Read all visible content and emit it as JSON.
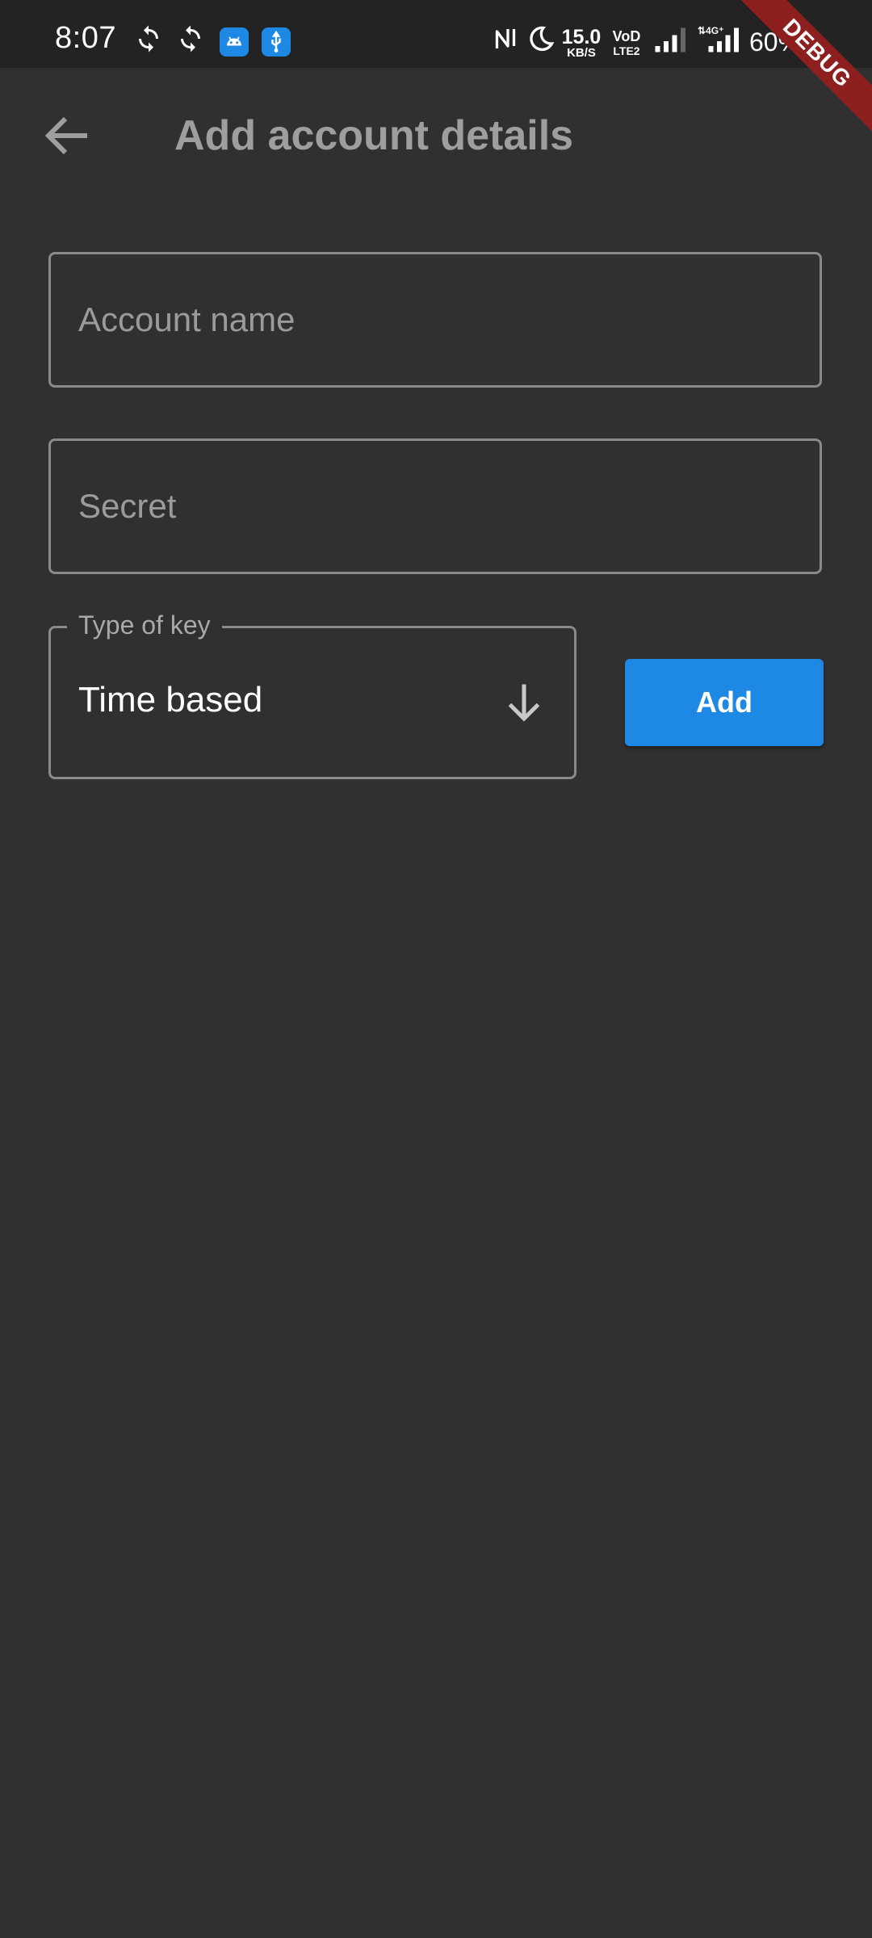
{
  "status_bar": {
    "time": "8:07",
    "net_speed_value": "15.0",
    "net_speed_unit": "KB/S",
    "vod_top": "VoD",
    "vod_bottom": "LTE2",
    "battery": "60%",
    "icons": [
      "sync-icon",
      "sync-icon",
      "android-debug-icon",
      "usb-icon",
      "nfc-icon",
      "moon-icon",
      "signal-icon",
      "signal-4g-icon"
    ]
  },
  "debug_banner": "DEBUG",
  "app_bar": {
    "title": "Add account details",
    "back_icon": "arrow-left-icon"
  },
  "form": {
    "account_name": {
      "placeholder": "Account name",
      "value": ""
    },
    "secret": {
      "placeholder": "Secret",
      "value": ""
    },
    "key_type": {
      "label": "Type of key",
      "selected": "Time based",
      "icon": "arrow-down-icon"
    },
    "add_button_label": "Add"
  },
  "colors": {
    "background": "#303030",
    "status_bar": "#232323",
    "accent": "#1e88e5",
    "border": "#8a8a8a",
    "debug_ribbon": "#8e1f1f"
  }
}
